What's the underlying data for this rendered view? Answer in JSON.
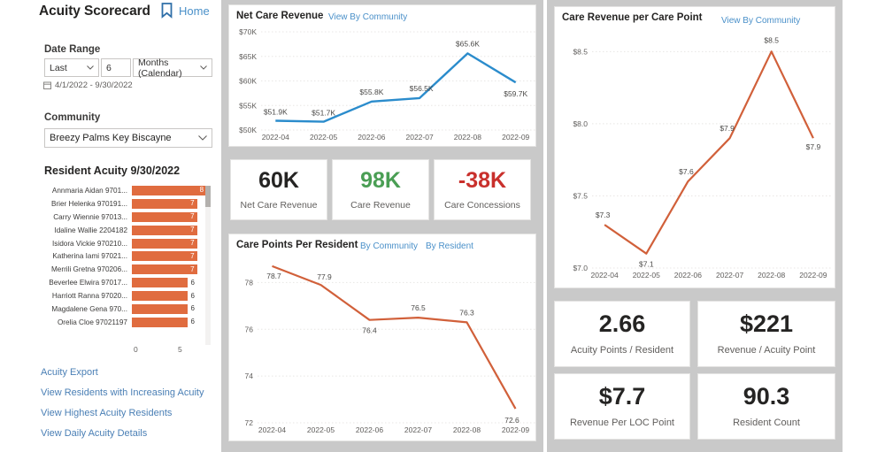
{
  "header": {
    "title": "Acuity Scorecard",
    "home_label": "Home",
    "home_icon": "bookmark-icon"
  },
  "filters": {
    "date_range_label": "Date Range",
    "relative": "Last",
    "count": "6",
    "unit": "Months (Calendar)",
    "range_text": "4/1/2022 - 9/30/2022",
    "calendar_icon": "calendar-icon",
    "community_label": "Community",
    "community_value": "Breezy Palms Key Biscayne"
  },
  "resident_acuity": {
    "heading": "Resident Acuity 9/30/2022",
    "axis_ticks": [
      "0",
      "5"
    ],
    "rows": [
      {
        "name": "Annmaria Aidan 9701...",
        "value": 8
      },
      {
        "name": "Brier Helenka 970191...",
        "value": 7
      },
      {
        "name": "Carry Wiennie 97013...",
        "value": 7
      },
      {
        "name": "Idaline Wallie 2204182",
        "value": 7
      },
      {
        "name": "Isidora Vickie 970210...",
        "value": 7
      },
      {
        "name": "Katherina Iami 97021...",
        "value": 7
      },
      {
        "name": "Merrili Gretna 970206...",
        "value": 7
      },
      {
        "name": "Beverlee Elwira 97017...",
        "value": 6
      },
      {
        "name": "Harriott Ranna 97020...",
        "value": 6
      },
      {
        "name": "Magdalene Gena 970...",
        "value": 6
      },
      {
        "name": "Orelia Cloe 97021197",
        "value": 6
      }
    ]
  },
  "side_links": [
    "Acuity Export",
    "View Residents with Increasing Acuity",
    "View Highest Acuity Residents",
    "View Daily Acuity Details"
  ],
  "kpis_middle": [
    {
      "value": "60K",
      "label": "Net Care Revenue",
      "color": "#252423"
    },
    {
      "value": "98K",
      "label": "Care Revenue",
      "color": "#4a9e54"
    },
    {
      "value": "-38K",
      "label": "Care Concessions",
      "color": "#c9302c"
    }
  ],
  "kpis_right": [
    {
      "value": "2.66",
      "label": "Acuity Points / Resident"
    },
    {
      "value": "$221",
      "label": "Revenue / Acuity Point"
    },
    {
      "value": "$7.7",
      "label": "Revenue Per LOC Point"
    },
    {
      "value": "90.3",
      "label": "Resident Count"
    }
  ],
  "cards": {
    "net_care_revenue": {
      "title": "Net Care Revenue",
      "actions": [
        "View By Community"
      ]
    },
    "care_points_per_resident": {
      "title": "Care Points Per Resident",
      "actions": [
        "By Community",
        "By Resident"
      ]
    },
    "care_revenue_per_care_point": {
      "title": "Care Revenue per Care Point",
      "actions": [
        "View By Community"
      ]
    }
  },
  "colors": {
    "accent_blue": "#2b8ccc",
    "accent_orange": "#d1603a",
    "bar_orange": "#e06c3f",
    "link_blue": "#4a90c9",
    "panel_gray": "#c9c9c9",
    "positive_green": "#4a9e54",
    "negative_red": "#c9302c"
  },
  "chart_data": [
    {
      "id": "net_care_revenue",
      "type": "line",
      "title": "Net Care Revenue",
      "xlabel": "",
      "ylabel": "",
      "categories": [
        "2022-04",
        "2022-05",
        "2022-06",
        "2022-07",
        "2022-08",
        "2022-09"
      ],
      "values": [
        51900,
        51700,
        55800,
        56500,
        65600,
        59700
      ],
      "data_labels": [
        "$51.9K",
        "$51.7K",
        "$55.8K",
        "$56.5K",
        "$65.6K",
        "$59.7K"
      ],
      "ytick_labels": [
        "$50K",
        "$55K",
        "$60K",
        "$65K",
        "$70K"
      ],
      "ylim": [
        50000,
        70000
      ],
      "grid": true,
      "legend": "none",
      "series_color": "#2b8ccc"
    },
    {
      "id": "care_points_per_resident",
      "type": "line",
      "title": "Care Points Per Resident",
      "xlabel": "",
      "ylabel": "",
      "categories": [
        "2022-04",
        "2022-05",
        "2022-06",
        "2022-07",
        "2022-08",
        "2022-09"
      ],
      "values": [
        78.7,
        77.9,
        76.4,
        76.5,
        76.3,
        72.6
      ],
      "data_labels": [
        "78.7",
        "77.9",
        "76.4",
        "76.5",
        "76.3",
        "72.6"
      ],
      "ytick_labels": [
        "72",
        "74",
        "76",
        "78"
      ],
      "ylim": [
        72,
        79
      ],
      "grid": true,
      "legend": "none",
      "series_color": "#d1603a"
    },
    {
      "id": "care_revenue_per_care_point",
      "type": "line",
      "title": "Care Revenue per Care Point",
      "xlabel": "",
      "ylabel": "",
      "categories": [
        "2022-04",
        "2022-05",
        "2022-06",
        "2022-07",
        "2022-08",
        "2022-09"
      ],
      "values": [
        7.3,
        7.1,
        7.6,
        7.9,
        8.5,
        7.9
      ],
      "data_labels": [
        "$7.3",
        "$7.1",
        "$7.6",
        "$7.9",
        "$8.5",
        "$7.9"
      ],
      "ytick_labels": [
        "$7.0",
        "$7.5",
        "$8.0",
        "$8.5"
      ],
      "ylim": [
        7.0,
        8.6
      ],
      "grid": true,
      "legend": "none",
      "series_color": "#d1603a"
    },
    {
      "id": "resident_acuity",
      "type": "bar",
      "orientation": "horizontal",
      "title": "Resident Acuity 9/30/2022",
      "categories": [
        "Annmaria Aidan 9701...",
        "Brier Helenka 970191...",
        "Carry Wiennie 97013...",
        "Idaline Wallie 2204182",
        "Isidora Vickie 970210...",
        "Katherina Iami 97021...",
        "Merrili Gretna 970206...",
        "Beverlee Elwira 97017...",
        "Harriott Ranna 97020...",
        "Magdalene Gena 970...",
        "Orelia Cloe 97021197"
      ],
      "values": [
        8,
        7,
        7,
        7,
        7,
        7,
        7,
        6,
        6,
        6,
        6
      ],
      "xtick_labels": [
        "0",
        "5"
      ],
      "xlim": [
        0,
        8.6
      ],
      "grid": false,
      "legend": "none",
      "series_color": "#e06c3f"
    }
  ]
}
